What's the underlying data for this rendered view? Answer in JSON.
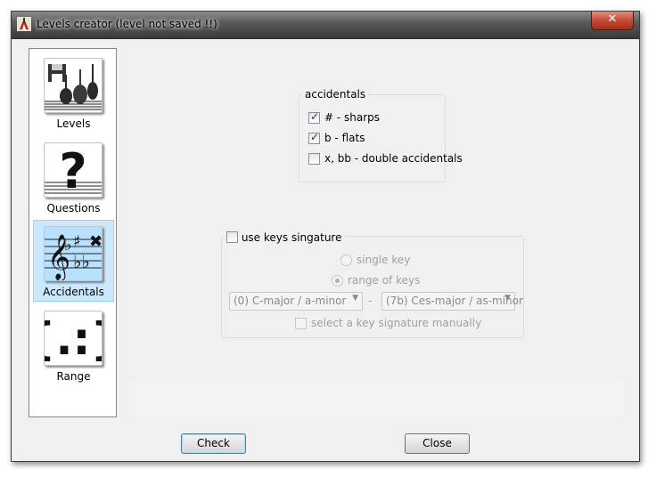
{
  "window": {
    "title": "Levels creator  (level not saved !!)",
    "close_label": "✕"
  },
  "sidebar": {
    "items": [
      {
        "label": "Levels",
        "icon": "levels-instruments-icon",
        "active": false
      },
      {
        "label": "Questions",
        "icon": "question-mark-icon",
        "active": false
      },
      {
        "label": "Accidentals",
        "icon": "treble-clef-accidentals-icon",
        "active": true
      },
      {
        "label": "Range",
        "icon": "braces-range-icon",
        "active": false
      }
    ]
  },
  "accidentals_group": {
    "legend": "accidentals",
    "sharps": {
      "label": "# - sharps",
      "checked": true
    },
    "flats": {
      "label": "b - flats",
      "checked": true
    },
    "double": {
      "label": "x, bb - double accidentals",
      "checked": false
    }
  },
  "keys_group": {
    "use_keys_label": "use keys singature",
    "use_keys_checked": false,
    "single_key_label": "single key",
    "range_of_keys_label": "range of keys",
    "selected_mode": "range of keys",
    "from_key": "(0) C-major / a-minor",
    "dash": "-",
    "to_key": "(7b) Ces-major / as-minor",
    "manual_label": "select a key signature manually",
    "manual_checked": false
  },
  "footer": {
    "check_label": "Check",
    "close_label": "Close"
  },
  "colors": {
    "selection_bg": "#cce8ff",
    "selection_border": "#99d1ff",
    "close_red": "#c54b37"
  }
}
